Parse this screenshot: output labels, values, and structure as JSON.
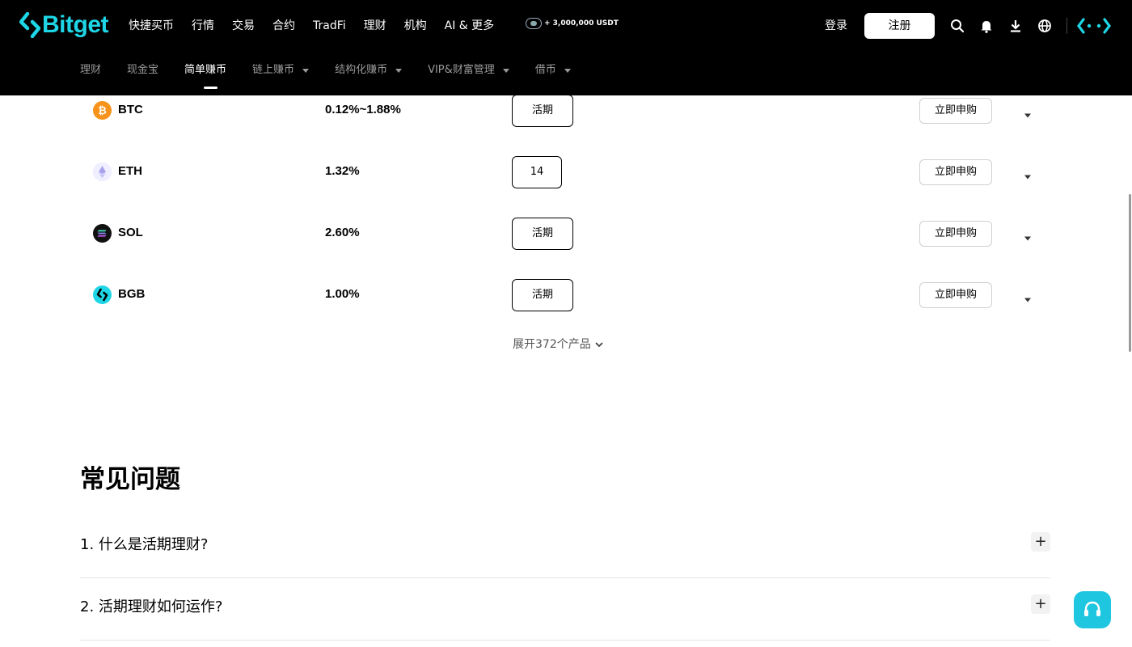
{
  "header": {
    "logo_text": "Bitget",
    "brand_color": "#1ed6e6",
    "nav": [
      "快捷买币",
      "行情",
      "交易",
      "合约",
      "TradFi",
      "理财",
      "机构",
      "AI & 更多"
    ],
    "promo": "+ 3,000,000 USDT",
    "login": "登录",
    "register": "注册",
    "icons": [
      "search-icon",
      "bell-icon",
      "download-icon",
      "globe-icon",
      "bitget-mark-icon"
    ]
  },
  "subnav": [
    {
      "label": "理财",
      "dropdown": false,
      "active": false
    },
    {
      "label": "现金宝",
      "dropdown": false,
      "active": false
    },
    {
      "label": "简单赚币",
      "dropdown": false,
      "active": true
    },
    {
      "label": "链上赚币",
      "dropdown": true,
      "active": false
    },
    {
      "label": "结构化赚币",
      "dropdown": true,
      "active": false
    },
    {
      "label": "VIP&财富管理",
      "dropdown": true,
      "active": false
    },
    {
      "label": "借币",
      "dropdown": true,
      "active": false
    }
  ],
  "products": [
    {
      "coin": "BTC",
      "icon": "btc-icon",
      "color": "#f7931a",
      "apr": "0.12%~1.88%",
      "term": "活期",
      "action": "立即申购"
    },
    {
      "coin": "ETH",
      "icon": "eth-icon",
      "color": "#c9c6f2",
      "apr": "1.32%",
      "term": "14",
      "action": "立即申购"
    },
    {
      "coin": "SOL",
      "icon": "sol-icon",
      "color": "#111111",
      "apr": "2.60%",
      "term": "活期",
      "action": "立即申购"
    },
    {
      "coin": "BGB",
      "icon": "bgb-icon",
      "color": "#1ed6e6",
      "apr": "1.00%",
      "term": "活期",
      "action": "立即申购"
    }
  ],
  "expand_label": "展开372个产品",
  "faq": {
    "title": "常见问题",
    "items": [
      "1. 什么是活期理财?",
      "2. 活期理财如何运作?"
    ]
  },
  "support_icon": "headset-icon"
}
